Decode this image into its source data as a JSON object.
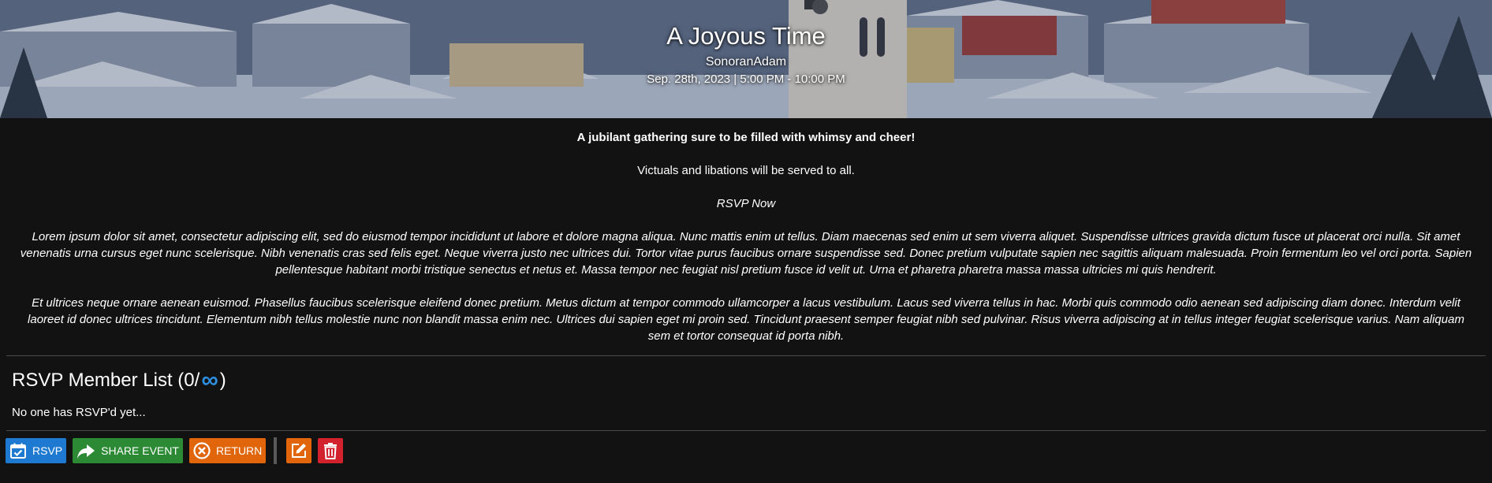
{
  "event": {
    "title": "A Joyous Time",
    "host": "SonoranAdam",
    "date_line": "Sep. 28th, 2023 | 5:00 PM - 10:00 PM"
  },
  "description": {
    "tagline": "A jubilant gathering sure to be filled with whimsy and cheer!",
    "line2": "Victuals and libations will be served to all.",
    "rsvp_now": "RSVP Now",
    "paragraph1": "Lorem ipsum dolor sit amet, consectetur adipiscing elit, sed do eiusmod tempor incididunt ut labore et dolore magna aliqua. Nunc mattis enim ut tellus. Diam maecenas sed enim ut sem viverra aliquet. Suspendisse ultrices gravida dictum fusce ut placerat orci nulla. Sit amet venenatis urna cursus eget nunc scelerisque. Nibh venenatis cras sed felis eget. Neque viverra justo nec ultrices dui. Tortor vitae purus faucibus ornare suspendisse sed. Donec pretium vulputate sapien nec sagittis aliquam malesuada. Proin fermentum leo vel orci porta. Sapien pellentesque habitant morbi tristique senectus et netus et. Massa tempor nec feugiat nisl pretium fusce id velit ut. Urna et pharetra pharetra massa massa ultricies mi quis hendrerit.",
    "paragraph2": "Et ultrices neque ornare aenean euismod. Phasellus faucibus scelerisque eleifend donec pretium. Metus dictum at tempor commodo ullamcorper a lacus vestibulum. Lacus sed viverra tellus in hac. Morbi quis commodo odio aenean sed adipiscing diam donec. Interdum velit laoreet id donec ultrices tincidunt. Elementum nibh tellus molestie nunc non blandit massa enim nec. Ultrices dui sapien eget mi proin sed. Tincidunt praesent semper feugiat nibh sed pulvinar. Risus viverra adipiscing at in tellus integer feugiat scelerisque varius. Nam aliquam sem et tortor consequat id porta nibh."
  },
  "rsvp_list": {
    "heading_prefix": "RSVP Member List (0/",
    "limit_symbol": "∞",
    "heading_suffix": ")",
    "empty_message": "No one has RSVP'd yet..."
  },
  "toolbar": {
    "rsvp_label": "RSVP",
    "share_label": "SHARE EVENT",
    "return_label": "RETURN",
    "icons": {
      "rsvp": "calendar-check-icon",
      "share": "share-arrow-icon",
      "return": "close-circle-icon",
      "edit": "edit-icon",
      "delete": "trash-icon"
    }
  },
  "colors": {
    "page_background": "#121212",
    "rsvp_button": "#1e7ad1",
    "share_button": "#2c8a35",
    "return_button": "#e0650b",
    "edit_button": "#e0650b",
    "delete_button": "#d2222d",
    "infinity_accent": "#2d8fe0"
  }
}
